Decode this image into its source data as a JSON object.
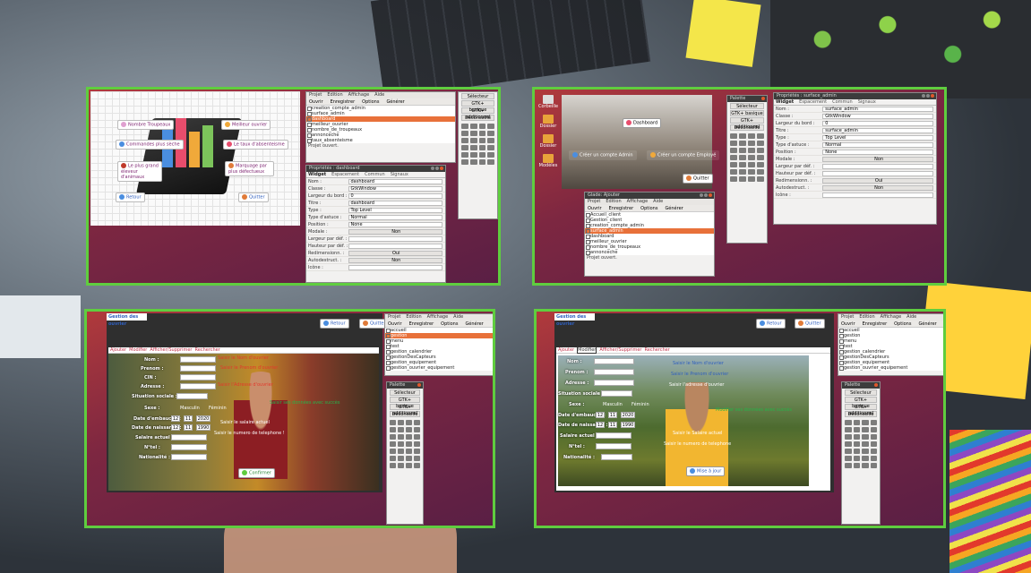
{
  "colors": {
    "panel_border": "#5fcd3f",
    "selection": "#e8713a",
    "link_blue": "#2f5fbf",
    "label_red": "#e3382b",
    "label_green": "#27b34a"
  },
  "panel1": {
    "window_menu": [
      "Projet",
      "Edition",
      "Affichage",
      "Aide"
    ],
    "toolbar": [
      "Ouvrir",
      "Enregistrer",
      "Options",
      "Générer"
    ],
    "tree": [
      "creation_compte_admin",
      "surface_admin",
      "dashboard",
      "meilleur_ouvrier",
      "nombre_de_troupeaux",
      "annonceche",
      "taux_absenteisme"
    ],
    "tree_selected": 2,
    "status": "Projet ouvert.",
    "palette": {
      "selector": "Sélecteur",
      "gtk_basique": "GTK+ basique",
      "gtk_add": "GTK+ additionnel",
      "deprecated": "Déconseillé"
    },
    "props_title": "Propriétés : dashboard",
    "tabs": [
      "Widget",
      "Espacement",
      "Commun",
      "Signaux"
    ],
    "props": [
      {
        "k": "Nom :",
        "v": "dashboard"
      },
      {
        "k": "Classe :",
        "v": "GtkWindow"
      },
      {
        "k": "Largeur du bord :",
        "v": "0"
      },
      {
        "k": "Titre :",
        "v": "dashboard"
      },
      {
        "k": "Type :",
        "v": "Top Level"
      },
      {
        "k": "Type d'astuce :",
        "v": "Normal"
      },
      {
        "k": "Position :",
        "v": "None"
      },
      {
        "k": "Modale :",
        "v": "Non"
      },
      {
        "k": "Largeur par déf. :",
        "v": ""
      },
      {
        "k": "Hauteur par déf. :",
        "v": ""
      },
      {
        "k": "Redimensionn. :",
        "v": "Oui"
      },
      {
        "k": "Autodestruct. :",
        "v": "Non"
      },
      {
        "k": "Icône :",
        "v": ""
      }
    ],
    "chips": [
      "Nombre Troupeaux",
      "Meilleur ouvrier",
      "Commandes plus sèche",
      "Le taux d'absenteisme",
      "Le plus grand éleveur d'animaux",
      "Marquage par plus défectueux",
      "Retour",
      "Quitter"
    ]
  },
  "panel2": {
    "desktop_icons": [
      "Corbeille",
      "Dossier",
      "Dossier",
      "Modèles"
    ],
    "dashboard_btn": "Dashboard",
    "creer_admin": "Créer un compte Admin",
    "creer_employe": "Créer un compte Employé",
    "quitter": "Quitter",
    "glade_title": "Glade: Ajouter",
    "menu": [
      "Projet",
      "Edition",
      "Affichage",
      "Aide"
    ],
    "toolbar": [
      "Ouvrir",
      "Enregistrer",
      "Options",
      "Générer"
    ],
    "tree": [
      "Accueil_client",
      "Gestion_client",
      "creation_compte_admin",
      "surface_admin",
      "dashboard",
      "meilleur_ouvrier",
      "nombre_de_troupeaux",
      "annonceche"
    ],
    "tree_selected": 3,
    "status": "Projet ouvert.",
    "palette_title": "Palette",
    "palette": {
      "selector": "Sélecteur",
      "gtk_basique": "GTK+ basique",
      "gtk_add": "GTK+ additionnel",
      "deprecated": "Déconseillé"
    },
    "props_title": "Propriétés : surface_admin",
    "tabs": [
      "Widget",
      "Espacement",
      "Commun",
      "Signaux"
    ],
    "props": [
      {
        "k": "Nom :",
        "v": "surface_admin"
      },
      {
        "k": "Classe :",
        "v": "GtkWindow"
      },
      {
        "k": "Largeur du bord :",
        "v": "0"
      },
      {
        "k": "Titre :",
        "v": "surface_admin"
      },
      {
        "k": "Type :",
        "v": "Top Level"
      },
      {
        "k": "Type d'astuce :",
        "v": "Normal"
      },
      {
        "k": "Position :",
        "v": "None"
      },
      {
        "k": "Modale :",
        "v": "Non"
      },
      {
        "k": "Largeur par déf. :",
        "v": ""
      },
      {
        "k": "Hauteur par déf. :",
        "v": ""
      },
      {
        "k": "Redimensionn. :",
        "v": "Oui"
      },
      {
        "k": "Autodestruct. :",
        "v": "Non"
      },
      {
        "k": "Icône :",
        "v": ""
      }
    ]
  },
  "panel3": {
    "app_title": "Gestion des ouvrier",
    "retour": "Retour",
    "quitter": "Quitter",
    "tabs": [
      "Ajouter",
      "Modifier",
      "Afficher/Supprimer",
      "Rechercher"
    ],
    "fields": [
      "Nom :",
      "Prenom :",
      "CIN :",
      "Adresse :",
      "Situation sociale :",
      "Sexe :",
      "Date d'embauche :",
      "Date de naissance :",
      "Salaire actuel :",
      "N°tel :",
      "Nationalité :"
    ],
    "sexe_opts": [
      "Masculin",
      "Féminin"
    ],
    "date1": [
      "12",
      "11",
      "2020"
    ],
    "date2": [
      "12",
      "11",
      "1990"
    ],
    "red": [
      "Saisir le Nom d'ouvrier",
      "Saisir le Prenom d'ouvrier",
      "Saisir l'Adresse d'ouvrier",
      "Saisir le salaire actuel",
      "Saisir le numero de telephone !"
    ],
    "green": [
      "Saisir ses données avec succès"
    ],
    "confirm": "Confirmer",
    "menu": [
      "Projet",
      "Edition",
      "Affichage",
      "Aide"
    ],
    "toolbar": [
      "Ouvrir",
      "Enregistrer",
      "Options",
      "Générer"
    ],
    "tree": [
      "accueil",
      "gestion",
      "menu",
      "test",
      "gestion_calendrier",
      "gestionDesCapteurs",
      "gestion_equipement",
      "gestion_ouvrier_equipement"
    ],
    "tree_selected": 1,
    "status": "Projet ouvert.",
    "palette_title": "Palette",
    "palette": {
      "selector": "Sélecteur",
      "gtk_basique": "GTK+ basique",
      "gtk_add": "GTK+ additionnel",
      "deprecated": "Déconseillé"
    }
  },
  "panel4": {
    "app_title": "Gestion des ouvrier",
    "retour": "Retour",
    "quitter": "Quitter",
    "tabs": [
      "Ajouter",
      "Modifier",
      "Afficher/Supprimer",
      "Rechercher"
    ],
    "fields": [
      "Nom :",
      "Prenom :",
      "Adresse :",
      "Situation sociale :",
      "Sexe :",
      "Date d'embauche :",
      "Date de naissance :",
      "Salaire actuel :",
      "N°tel :",
      "Nationalité :"
    ],
    "sexe_opts": [
      "Masculin",
      "Féminin"
    ],
    "date1": [
      "12",
      "11",
      "2020"
    ],
    "date2": [
      "12",
      "11",
      "1990"
    ],
    "red": [
      "Saisir le Nom d'ouvrier",
      "Saisir le Prenom d'ouvrier",
      "Saisir l'adresse d'ouvrier",
      "Saisir le Salaire actuel",
      "Saisir le numero de telephone"
    ],
    "green": [
      "Modifier ses données avec succès"
    ],
    "confirm": "Mise à jour",
    "menu": [
      "Projet",
      "Edition",
      "Affichage",
      "Aide"
    ],
    "toolbar": [
      "Ouvrir",
      "Enregistrer",
      "Options",
      "Générer"
    ],
    "tree": [
      "accueil",
      "gestion",
      "menu",
      "test",
      "gestion_calendrier",
      "gestionDesCapteurs",
      "gestion_equipement",
      "gestion_ouvrier_equipement"
    ],
    "status": "Projet ouvert.",
    "palette_title": "Palette",
    "palette": {
      "selector": "Sélecteur",
      "gtk_basique": "GTK+ basique",
      "gtk_add": "GTK+ additionnel",
      "deprecated": "Déconseillé"
    }
  }
}
